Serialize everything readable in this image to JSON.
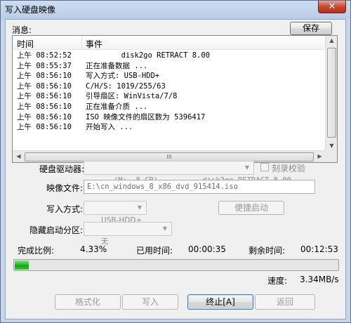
{
  "window": {
    "title": "写入硬盘映像",
    "close_glyph": "✕"
  },
  "messages": {
    "label": "消息:",
    "save_label": "保存",
    "columns": {
      "time": "时间",
      "event": "事件"
    },
    "rows": [
      {
        "time": "上午 08:52:52",
        "event": "        disk2go RETRACT 8.00"
      },
      {
        "time": "上午 08:55:37",
        "event": "正在准备数据 ..."
      },
      {
        "time": "上午 08:56:10",
        "event": "写入方式: USB-HDD+"
      },
      {
        "time": "上午 08:56:10",
        "event": "C/H/S: 1019/255/63"
      },
      {
        "time": "上午 08:56:10",
        "event": "引导扇区: WinVista/7/8"
      },
      {
        "time": "上午 08:56:10",
        "event": "正在准备介质 ..."
      },
      {
        "time": "上午 08:56:10",
        "event": "ISO 映像文件的扇区数为 5396417"
      },
      {
        "time": "上午 08:56:10",
        "event": "开始写入 ..."
      }
    ],
    "hscroll_grip": "III"
  },
  "form": {
    "drive_label": "硬盘驱动器:",
    "drive_value": "(M:, 8 GB)          disk2go RETRACT 8.00",
    "verify_label": "刻录校验",
    "image_label": "映像文件:",
    "image_value": "E:\\cn_windows_8_x86_dvd_915414.iso",
    "write_mode_label": "写入方式:",
    "write_mode_value": "USB-HDD+",
    "easy_boot_label": "便捷启动",
    "hidden_partition_label": "隐藏启动分区:",
    "hidden_partition_value": "无"
  },
  "status": {
    "ratio_label": "完成比例:",
    "ratio_value": "4.33%",
    "elapsed_label": "已用时间:",
    "elapsed_value": "00:00:35",
    "remaining_label": "剩余时间:",
    "remaining_value": "00:12:53",
    "progress_fraction": 0.0433,
    "speed_label": "速度:",
    "speed_value": "3.34MB/s"
  },
  "buttons": {
    "format": "格式化",
    "write": "写入",
    "abort": "终止[A]",
    "back": "返回"
  },
  "colors": {
    "progress": "#19a919",
    "title_bar": "#c4d5ec",
    "close": "#c9472f"
  }
}
